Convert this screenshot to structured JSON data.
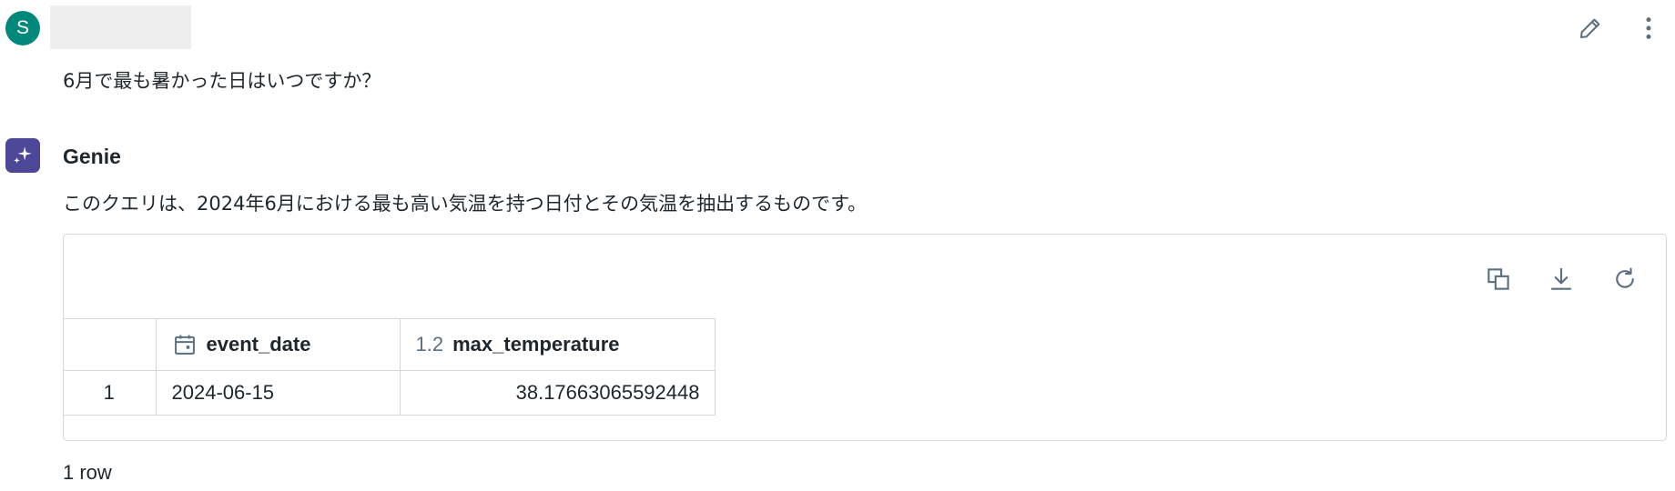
{
  "user": {
    "avatar_initial": "S",
    "question": "6月で最も暑かった日はいつですか？",
    "actions": {
      "edit_icon": "pencil-icon",
      "more_icon": "kebab-menu-icon"
    }
  },
  "genie": {
    "avatar_icon": "sparkle-icon",
    "name": "Genie",
    "description": "このクエリは、2024年6月における最も高い気温を持つ日付とその気温を抽出するものです。"
  },
  "result": {
    "toolbar": {
      "copy_icon": "copy-icon",
      "download_icon": "download-icon",
      "refresh_icon": "refresh-icon"
    },
    "columns": [
      {
        "type_icon": "calendar-icon",
        "name": "event_date"
      },
      {
        "type_badge": "1.2",
        "name": "max_temperature"
      }
    ],
    "rows": [
      {
        "index": "1",
        "event_date": "2024-06-15",
        "max_temperature": "38.17663065592448"
      }
    ],
    "row_count": "1 row"
  },
  "colors": {
    "user_avatar": "#00897b",
    "genie_avatar": "#4c4796",
    "border": "#d3d8dc",
    "icon": "#5a6f80"
  }
}
